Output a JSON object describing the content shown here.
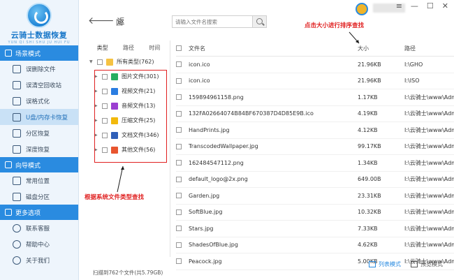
{
  "app": {
    "title": "云骑士数据恢复",
    "subtitle": "YUN QI SHI SHU JU HUI FU"
  },
  "sidebar": {
    "sections": [
      {
        "title": "场景模式",
        "items": [
          {
            "label": "误删除文件",
            "active": false
          },
          {
            "label": "误清空回收站",
            "active": false
          },
          {
            "label": "误格式化",
            "active": false
          },
          {
            "label": "U盘/内存卡恢复",
            "active": true
          },
          {
            "label": "分区恢复",
            "active": false
          },
          {
            "label": "深度恢复",
            "active": false
          }
        ]
      },
      {
        "title": "向导模式",
        "items": [
          {
            "label": "常用位置",
            "active": false
          },
          {
            "label": "磁盘分区",
            "active": false
          }
        ]
      },
      {
        "title": "更多选项",
        "items": [
          {
            "label": "联系客服",
            "active": false
          },
          {
            "label": "帮助中心",
            "active": false
          },
          {
            "label": "关于我们",
            "active": false
          }
        ]
      }
    ]
  },
  "topbar": {
    "back_label": "返",
    "home_label": "回",
    "search_placeholder": "请输入文件名搜索",
    "window_controls": [
      "≡",
      "—",
      "☐",
      "✕"
    ]
  },
  "type_panel": {
    "tabs": [
      "类型",
      "路径",
      "时间"
    ],
    "root": "所有类型(762)",
    "types": [
      {
        "label": "图片文件(301)",
        "icon": "image-icon",
        "color": "#27ae60"
      },
      {
        "label": "视频文件(21)",
        "icon": "video-icon",
        "color": "#2a7de1"
      },
      {
        "label": "音频文件(13)",
        "icon": "audio-icon",
        "color": "#9b3fd1"
      },
      {
        "label": "压缩文件(25)",
        "icon": "archive-icon",
        "color": "#f2b90c"
      },
      {
        "label": "文档文件(346)",
        "icon": "document-icon",
        "color": "#2f5fb8"
      },
      {
        "label": "其他文件(56)",
        "icon": "other-icon",
        "color": "#e8552f"
      }
    ]
  },
  "table": {
    "headers": {
      "name": "文件名",
      "size": "大小",
      "path": "路径"
    },
    "rows": [
      {
        "name": "icon.ico",
        "size": "21.96KB",
        "path": "I:\\GHO"
      },
      {
        "name": "icon.ico",
        "size": "21.96KB",
        "path": "I:\\ISO"
      },
      {
        "name": "159894961158.png",
        "size": "1.17KB",
        "path": "I:\\云骑士\\www\\Administ"
      },
      {
        "name": "132FA02664074B84BF670387D4D85E9B.ico",
        "size": "4.19KB",
        "path": "I:\\云骑士\\www\\Administ"
      },
      {
        "name": "HandPrints.jpg",
        "size": "4.12KB",
        "path": "I:\\云骑士\\www\\Administ"
      },
      {
        "name": "TranscodedWallpaper.jpg",
        "size": "99.17KB",
        "path": "I:\\云骑士\\www\\Administ"
      },
      {
        "name": "162484547112.png",
        "size": "1.34KB",
        "path": "I:\\云骑士\\www\\Administ"
      },
      {
        "name": "default_logo@2x.png",
        "size": "649.00B",
        "path": "I:\\云骑士\\www\\Administ"
      },
      {
        "name": "Garden.jpg",
        "size": "23.31KB",
        "path": "I:\\云骑士\\www\\Administ"
      },
      {
        "name": "SoftBlue.jpg",
        "size": "10.32KB",
        "path": "I:\\云骑士\\www\\Administ"
      },
      {
        "name": "Stars.jpg",
        "size": "7.33KB",
        "path": "I:\\云骑士\\www\\Administ"
      },
      {
        "name": "ShadesOfBlue.jpg",
        "size": "4.62KB",
        "path": "I:\\云骑士\\www\\Administ"
      },
      {
        "name": "Peacock.jpg",
        "size": "5.00KB",
        "path": "I:\\云骑士\\www\\Administ"
      }
    ]
  },
  "annotations": {
    "top": "点击大小进行排序查找",
    "left": "根据系统文件类型查找"
  },
  "footer": {
    "status": "扫描到762个文件(共5.79GB)",
    "list_view": "列表模式",
    "preview_view": "预览模式"
  },
  "colors": {
    "accent": "#2a8be0",
    "annotation": "#e02020"
  }
}
